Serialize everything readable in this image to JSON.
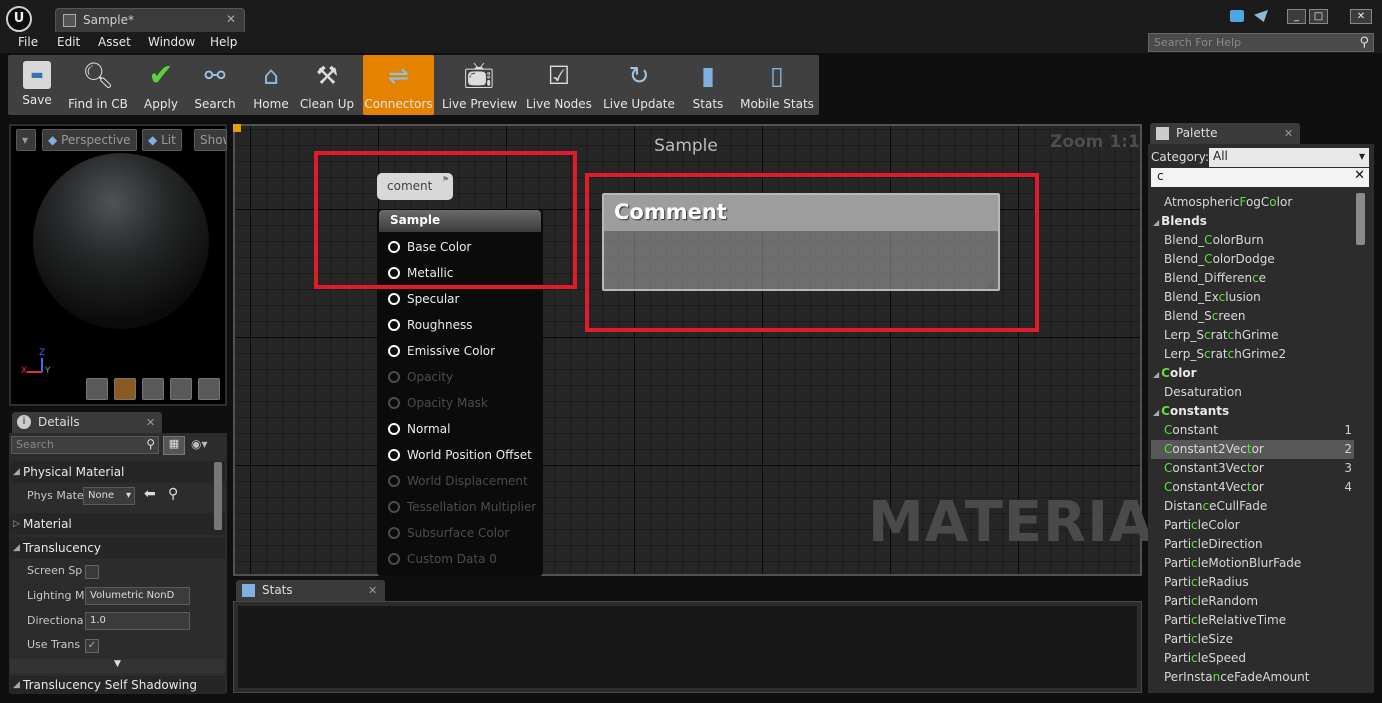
{
  "window": {
    "tab_title": "Sample*",
    "tab_close": "✕",
    "min": "_",
    "max": "□",
    "close": "✕"
  },
  "menu": [
    "File",
    "Edit",
    "Asset",
    "Window",
    "Help"
  ],
  "help_search": {
    "placeholder": "Search For Help"
  },
  "toolbar": {
    "buttons": [
      {
        "label": "Save",
        "icon": "save-icon"
      },
      {
        "label": "Find in CB",
        "icon": "magnifier-icon"
      },
      {
        "label": "Apply",
        "icon": "checkmark-icon"
      },
      {
        "label": "Search",
        "icon": "binoculars-icon"
      },
      {
        "label": "Home",
        "icon": "house-icon"
      },
      {
        "label": "Clean Up",
        "icon": "broom-icon"
      },
      {
        "label": "Connectors",
        "icon": "connectors-icon",
        "active": true
      },
      {
        "label": "Live Preview",
        "icon": "tv-icon"
      },
      {
        "label": "Live Nodes",
        "icon": "live-nodes-icon"
      },
      {
        "label": "Live Update",
        "icon": "live-update-icon"
      },
      {
        "label": "Stats",
        "icon": "bar-chart-icon"
      },
      {
        "label": "Mobile Stats",
        "icon": "mobile-stats-icon"
      }
    ]
  },
  "viewport": {
    "perspective": "Perspective",
    "lit": "Lit",
    "show": "Show",
    "axis_x": "X",
    "axis_y": "Y",
    "axis_z": "Z"
  },
  "details": {
    "tab": "Details",
    "search_placeholder": "Search",
    "sections": {
      "physical_material": "Physical Material",
      "material": "Material",
      "translucency": "Translucency",
      "self_shadowing": "Translucency Self Shadowing"
    },
    "props": {
      "phys_mat_label": "Phys Mate",
      "phys_mat_value": "None",
      "screen_space_label": "Screen Sp",
      "lighting_mode_label": "Lighting M",
      "lighting_mode_value": "Volumetric NonD",
      "directional_label": "Directiona",
      "directional_value": "1.0",
      "use_trans_label": "Use Trans",
      "use_trans_check": "✓"
    }
  },
  "graph": {
    "title": "Sample",
    "zoom": "Zoom 1:1",
    "watermark": "MATERIAL",
    "bubble": "coment",
    "node_title": "Sample",
    "pins": [
      {
        "label": "Base Color",
        "enabled": true
      },
      {
        "label": "Metallic",
        "enabled": true
      },
      {
        "label": "Specular",
        "enabled": true
      },
      {
        "label": "Roughness",
        "enabled": true
      },
      {
        "label": "Emissive Color",
        "enabled": true
      },
      {
        "label": "Opacity",
        "enabled": false
      },
      {
        "label": "Opacity Mask",
        "enabled": false
      },
      {
        "label": "Normal",
        "enabled": true
      },
      {
        "label": "World Position Offset",
        "enabled": true
      },
      {
        "label": "World Displacement",
        "enabled": false
      },
      {
        "label": "Tessellation Multiplier",
        "enabled": false
      },
      {
        "label": "Subsurface Color",
        "enabled": false
      },
      {
        "label": "Custom Data 0",
        "enabled": false
      }
    ],
    "comment_title": "Comment"
  },
  "stats": {
    "tab": "Stats"
  },
  "palette": {
    "tab": "Palette",
    "category_label": "Category:",
    "category_value": "All",
    "search_value": "c",
    "items": [
      {
        "text": "AtmosphericFogColor",
        "hl": [
          [
            11,
            12
          ],
          [
            15,
            16
          ]
        ]
      },
      {
        "text": "Blends",
        "cat": true,
        "hl": []
      },
      {
        "text": "Blend_ColorBurn",
        "hl": [
          [
            6,
            7
          ]
        ]
      },
      {
        "text": "Blend_ColorDodge",
        "hl": [
          [
            6,
            7
          ]
        ]
      },
      {
        "text": "Blend_Difference",
        "hl": [
          [
            14,
            15
          ]
        ]
      },
      {
        "text": "Blend_Exclusion",
        "hl": [
          [
            8,
            9
          ]
        ]
      },
      {
        "text": "Blend_Screen",
        "hl": [
          [
            7,
            8
          ]
        ]
      },
      {
        "text": "Lerp_ScratchGrime",
        "hl": [
          [
            6,
            7
          ],
          [
            10,
            11
          ]
        ]
      },
      {
        "text": "Lerp_ScratchGrime2",
        "hl": [
          [
            6,
            7
          ],
          [
            10,
            11
          ]
        ]
      },
      {
        "text": "Color",
        "cat": true,
        "hl": [
          [
            0,
            1
          ]
        ]
      },
      {
        "text": "Desaturation",
        "hl": []
      },
      {
        "text": "Constants",
        "cat": true,
        "hl": [
          [
            0,
            1
          ]
        ]
      },
      {
        "text": "Constant",
        "key": "1",
        "hl": [
          [
            0,
            1
          ]
        ]
      },
      {
        "text": "Constant2Vector",
        "key": "2",
        "sel": true,
        "hl": [
          [
            0,
            1
          ],
          [
            12,
            13
          ]
        ]
      },
      {
        "text": "Constant3Vector",
        "key": "3",
        "hl": [
          [
            0,
            1
          ],
          [
            12,
            13
          ]
        ]
      },
      {
        "text": "Constant4Vector",
        "key": "4",
        "hl": [
          [
            0,
            1
          ],
          [
            12,
            13
          ]
        ]
      },
      {
        "text": "DistanceCullFade",
        "hl": [
          [
            6,
            7
          ]
        ]
      },
      {
        "text": "ParticleColor",
        "hl": [
          [
            5,
            6
          ]
        ]
      },
      {
        "text": "ParticleDirection",
        "hl": [
          [
            5,
            6
          ]
        ]
      },
      {
        "text": "ParticleMotionBlurFade",
        "hl": [
          [
            5,
            6
          ]
        ]
      },
      {
        "text": "ParticleRadius",
        "hl": [
          [
            5,
            6
          ]
        ]
      },
      {
        "text": "ParticleRandom",
        "hl": [
          [
            5,
            6
          ]
        ]
      },
      {
        "text": "ParticleRelativeTime",
        "hl": [
          [
            5,
            6
          ]
        ]
      },
      {
        "text": "ParticleSize",
        "hl": [
          [
            5,
            6
          ]
        ]
      },
      {
        "text": "ParticleSpeed",
        "hl": [
          [
            5,
            6
          ]
        ]
      },
      {
        "text": "PerInstanceFadeAmount",
        "hl": [
          [
            8,
            9
          ]
        ]
      }
    ]
  },
  "colors": {
    "accent_active": "#e58200",
    "highlight_box": "#e11c2a",
    "search_match": "#5fe03a"
  }
}
